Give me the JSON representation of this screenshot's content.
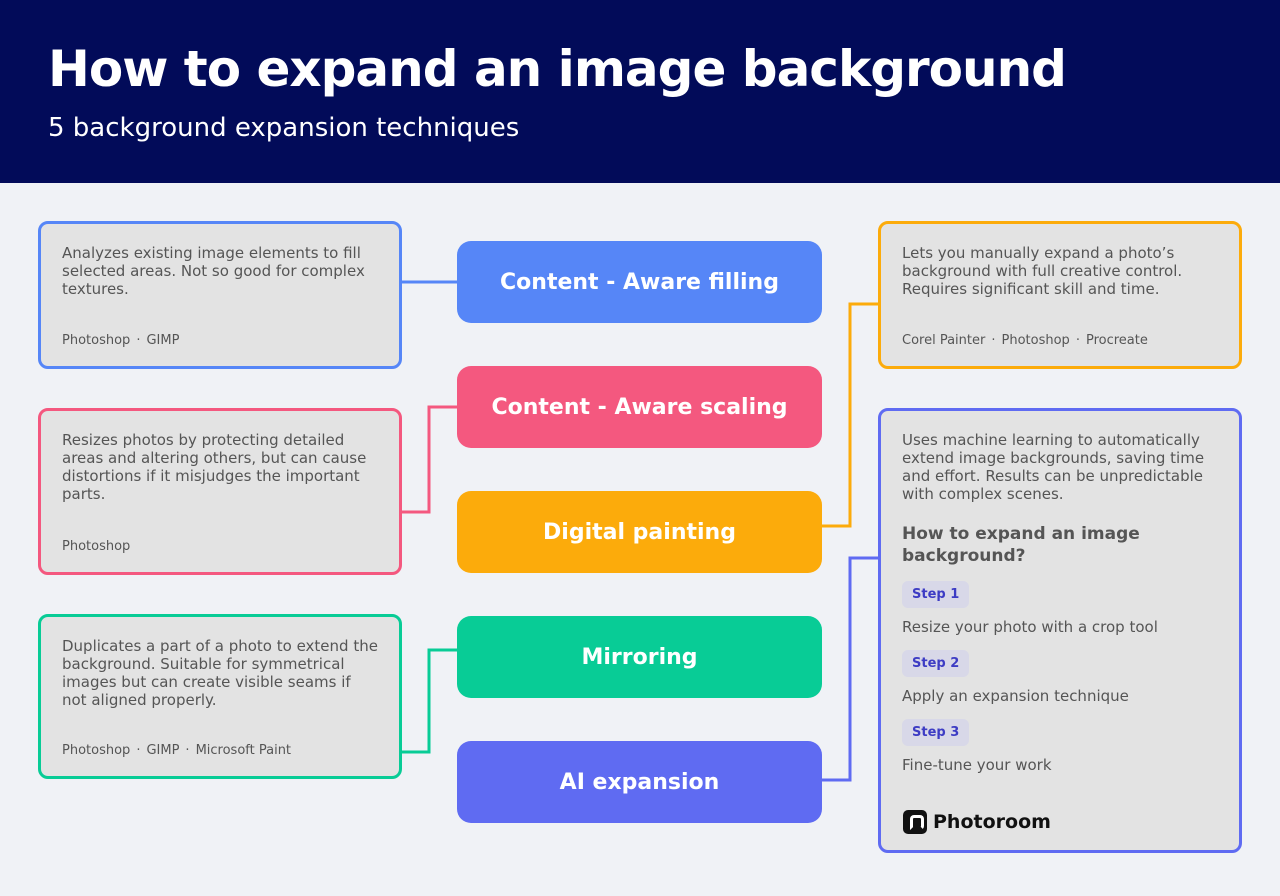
{
  "header": {
    "title": "How to expand an image background",
    "subtitle": "5 background expansion techniques"
  },
  "colors": {
    "header_bg": "#020b59",
    "content_aware_filling": "#5686f7",
    "content_aware_scaling": "#f4587f",
    "digital_painting": "#fcab0b",
    "mirroring": "#08cc96",
    "ai_expansion": "#5f6bf2"
  },
  "techniques": [
    {
      "label": "Content - Aware filling",
      "description": "Analyzes existing image elements to fill selected areas. Not so good for complex textures.",
      "tools": [
        "Photoshop",
        "GIMP"
      ]
    },
    {
      "label": "Content - Aware scaling",
      "description": "Resizes photos by protecting detailed areas and altering others, but can cause distortions if it misjudges the important parts.",
      "tools": [
        "Photoshop"
      ]
    },
    {
      "label": "Digital painting",
      "description": "Lets you manually expand a photo’s background with full creative control. Requires significant skill and time.",
      "tools": [
        "Corel Painter",
        "Photoshop",
        "Procreate"
      ]
    },
    {
      "label": "Mirroring",
      "description": "Duplicates a part of a photo to extend the background. Suitable for symmetrical images but can create visible seams if not aligned properly.",
      "tools": [
        "Photoshop",
        "GIMP",
        "Microsoft Paint"
      ]
    },
    {
      "label": "AI expansion",
      "description": "Uses machine learning to automatically extend image backgrounds, saving time and effort. Results can be unpredictable with complex scenes."
    }
  ],
  "steps_section": {
    "title": "How to expand an image background?",
    "steps": [
      {
        "badge": "Step 1",
        "text": "Resize your photo with a crop tool"
      },
      {
        "badge": "Step 2",
        "text": "Apply an expansion technique"
      },
      {
        "badge": "Step 3",
        "text": "Fine-tune your work"
      }
    ]
  },
  "brand": {
    "name": "Photoroom",
    "icon": "photoroom-logo-icon"
  },
  "tool_separator": "·"
}
